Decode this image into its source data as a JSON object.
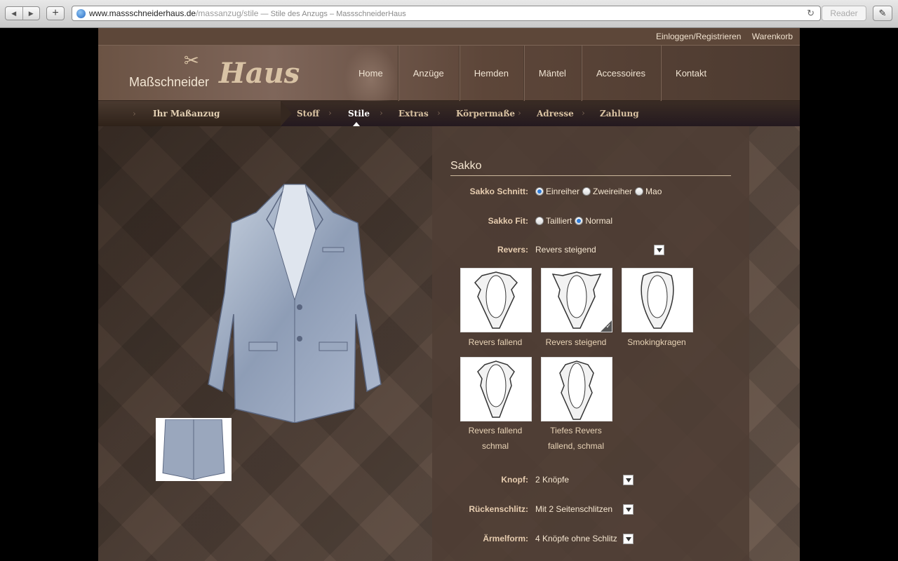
{
  "browser": {
    "url_host": "www.massschneiderhaus.de",
    "url_path": "/massanzug/stile",
    "page_title": " — Stile des Anzugs – MassschneiderHaus",
    "reader_label": "Reader",
    "back_glyph": "◀",
    "forward_glyph": "▶",
    "add_glyph": "+",
    "reload_glyph": "↻",
    "ext_glyph": "✎"
  },
  "topbar": {
    "login": "Einloggen/Registrieren",
    "cart": "Warenkorb"
  },
  "logo": {
    "small": "Maßschneider",
    "big": "Haus"
  },
  "mainnav": [
    "Home",
    "Anzüge",
    "Hemden",
    "Mäntel",
    "Accessoires",
    "Kontakt"
  ],
  "steps": {
    "first": "Ihr Maßanzug",
    "items": [
      "Stoff",
      "Stile",
      "Extras",
      "Körpermaße",
      "Adresse",
      "Zahlung"
    ],
    "active": "Stile"
  },
  "panel": {
    "title": "Sakko",
    "schnitt": {
      "label": "Sakko Schnitt:",
      "options": [
        "Einreiher",
        "Zweireiher",
        "Mao"
      ],
      "selected": "Einreiher"
    },
    "fit": {
      "label": "Sakko Fit:",
      "options": [
        "Tailliert",
        "Normal"
      ],
      "selected": "Normal"
    },
    "revers": {
      "label": "Revers:",
      "value": "Revers steigend"
    },
    "tiles": [
      {
        "caption": "Revers fallend"
      },
      {
        "caption": "Revers steigend",
        "selected": true
      },
      {
        "caption": "Smokingkragen"
      },
      {
        "caption_lines": [
          "Revers fallend",
          "schmal"
        ]
      },
      {
        "caption_lines": [
          "Tiefes Revers",
          "fallend, schmal"
        ]
      }
    ],
    "knopf": {
      "label": "Knopf:",
      "value": "2 Knöpfe"
    },
    "rueckenschlitz": {
      "label": "Rückenschlitz:",
      "value": "Mit 2 Seitenschlitzen"
    },
    "aermelform": {
      "label": "Ärmelform:",
      "value": "4 Knöpfe ohne Schlitz"
    }
  },
  "colors": {
    "accent_text": "#e7cdb0",
    "radio_dot": "#2f7cd9",
    "panel_bg": "#4e3e34"
  }
}
